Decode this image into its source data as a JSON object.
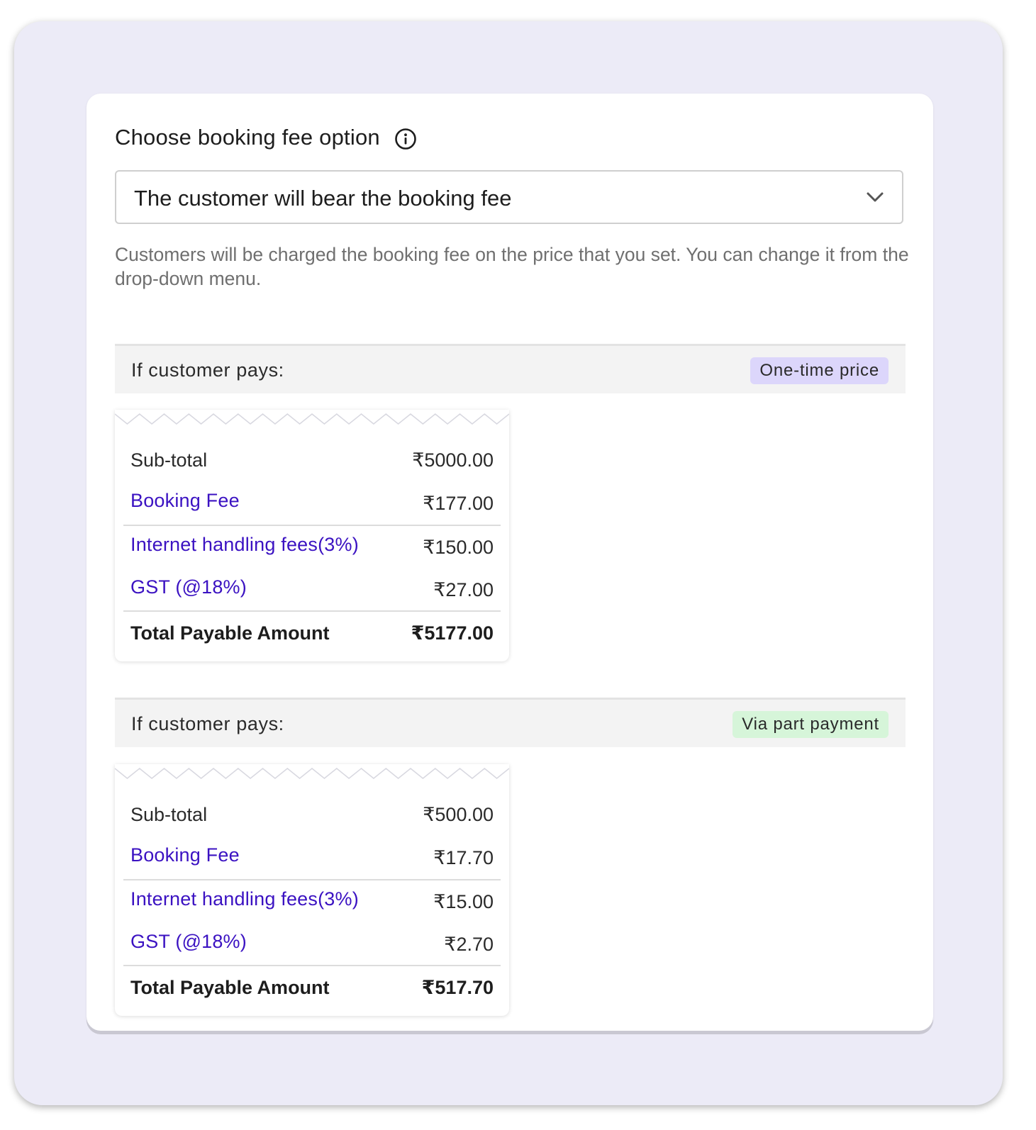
{
  "booking_fee": {
    "label": "Choose booking fee option",
    "info_icon": "info-circle-icon",
    "select_value": "The customer will bear the booking fee",
    "help_text": "Customers will be charged the booking fee on the price that you set. You can change it from the drop-down menu."
  },
  "sections": [
    {
      "title": "If customer pays:",
      "badge": "One-time price",
      "badge_color": "#dcd6fb",
      "rows": {
        "subtotal_label": "Sub-total",
        "subtotal_value": "₹5000.00",
        "booking_fee_label": "Booking Fee",
        "booking_fee_value": "₹177.00",
        "internet_label": "Internet handling fees(3%)",
        "internet_value": "₹150.00",
        "gst_label": "GST (@18%)",
        "gst_value": "₹27.00",
        "total_label": "Total Payable Amount",
        "total_value": "₹5177.00"
      }
    },
    {
      "title": "If customer pays:",
      "badge": "Via part payment",
      "badge_color": "#d6f5d9",
      "rows": {
        "subtotal_label": "Sub-total",
        "subtotal_value": "₹500.00",
        "booking_fee_label": "Booking Fee",
        "booking_fee_value": "₹17.70",
        "internet_label": "Internet handling fees(3%)",
        "internet_value": "₹15.00",
        "gst_label": "GST (@18%)",
        "gst_value": "₹2.70",
        "total_label": "Total Payable Amount",
        "total_value": "₹517.70"
      }
    }
  ],
  "colors": {
    "link": "#3b12c2",
    "outer_background": "#ecebf7"
  }
}
